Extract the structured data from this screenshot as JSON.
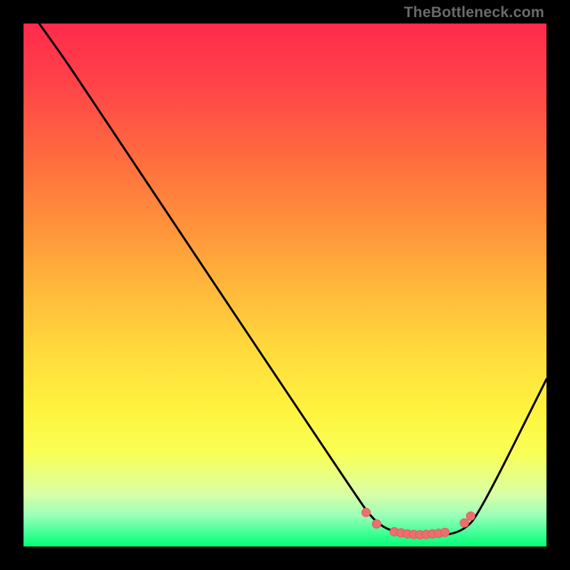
{
  "attribution": "TheBottleneck.com",
  "colors": {
    "background": "#000000",
    "curve_stroke": "#000000",
    "marker_fill": "#eb6f6f",
    "marker_stroke": "#e05a5a"
  },
  "chart_data": {
    "type": "line",
    "title": "",
    "xlabel": "",
    "ylabel": "",
    "xlim": [
      0,
      100
    ],
    "ylim": [
      0,
      100
    ],
    "series": [
      {
        "name": "bottleneck-curve",
        "points": [
          {
            "x": 3,
            "y": 100
          },
          {
            "x": 8,
            "y": 93
          },
          {
            "x": 12,
            "y": 87
          },
          {
            "x": 64,
            "y": 9
          },
          {
            "x": 67,
            "y": 5
          },
          {
            "x": 70,
            "y": 3
          },
          {
            "x": 75,
            "y": 2
          },
          {
            "x": 80,
            "y": 2
          },
          {
            "x": 84,
            "y": 3
          },
          {
            "x": 87,
            "y": 6
          },
          {
            "x": 100,
            "y": 32
          }
        ]
      }
    ],
    "markers": [
      {
        "x": 65.5,
        "y": 6.5
      },
      {
        "x": 67.5,
        "y": 4.3
      },
      {
        "x": 70.9,
        "y": 2.8
      },
      {
        "x": 72.2,
        "y": 2.6
      },
      {
        "x": 73.4,
        "y": 2.4
      },
      {
        "x": 74.6,
        "y": 2.3
      },
      {
        "x": 75.8,
        "y": 2.25
      },
      {
        "x": 77.0,
        "y": 2.3
      },
      {
        "x": 78.2,
        "y": 2.4
      },
      {
        "x": 79.4,
        "y": 2.5
      },
      {
        "x": 80.6,
        "y": 2.7
      },
      {
        "x": 84.3,
        "y": 4.5
      },
      {
        "x": 85.5,
        "y": 5.8
      }
    ]
  }
}
